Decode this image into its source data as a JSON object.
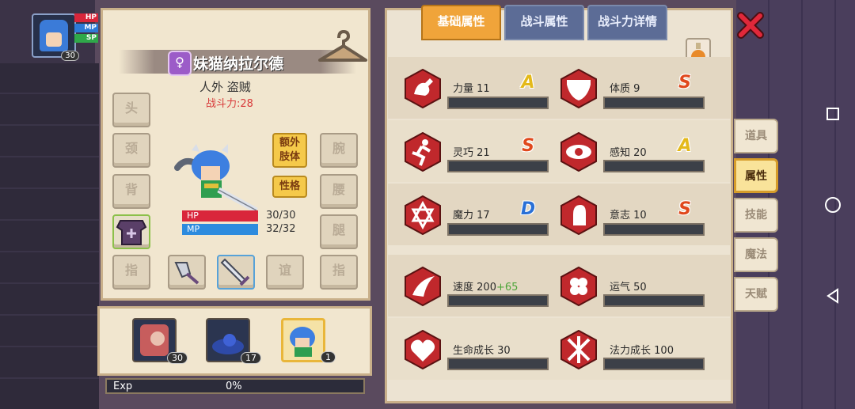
{
  "player": {
    "level": "30",
    "bars": [
      "HP",
      "MP",
      "SP"
    ]
  },
  "character": {
    "gender_symbol": "♀",
    "name": "妹猫纳拉尔德",
    "race_class": "人外 盗贼",
    "combat_power": "战斗力:28",
    "hp_label": "HP",
    "hp_value": "30/30",
    "mp_label": "MP",
    "mp_value": "32/32"
  },
  "equipment_slots": {
    "head": "头",
    "neck": "颈",
    "back": "背",
    "ring_left": "指",
    "wrist_left": "腕",
    "waist": "腰",
    "leg": "腿",
    "ring_right": "指",
    "arm": "谊"
  },
  "buttons": {
    "extra_limbs": "额外\n肢体",
    "personality": "性格"
  },
  "party": [
    {
      "level": "30"
    },
    {
      "level": "17"
    },
    {
      "level": "1"
    }
  ],
  "exp": {
    "label": "Exp",
    "value": "0%"
  },
  "tabs": [
    "基础属性",
    "战斗属性",
    "战斗力详情"
  ],
  "attributes": [
    {
      "label": "力量",
      "value": "11",
      "grade": "A"
    },
    {
      "label": "体质",
      "value": "9",
      "grade": "S"
    },
    {
      "label": "灵巧",
      "value": "21",
      "grade": "S"
    },
    {
      "label": "感知",
      "value": "20",
      "grade": "A"
    },
    {
      "label": "魔力",
      "value": "17",
      "grade": "D"
    },
    {
      "label": "意志",
      "value": "10",
      "grade": "S"
    }
  ],
  "secondary": [
    {
      "label": "速度",
      "value": "200",
      "bonus": "+65"
    },
    {
      "label": "运气",
      "value": "50"
    },
    {
      "label": "生命成长",
      "value": "30"
    },
    {
      "label": "法力成长",
      "value": "100"
    }
  ],
  "side_menu": [
    "道具",
    "属性",
    "技能",
    "魔法",
    "天赋"
  ],
  "side_active": "属性",
  "colors": {
    "accent_tab": "#f0a43a",
    "tab_inactive": "#5c6c96",
    "grade_S": "#e0481c",
    "grade_A": "#e4b91a",
    "grade_D": "#2a70d6"
  }
}
